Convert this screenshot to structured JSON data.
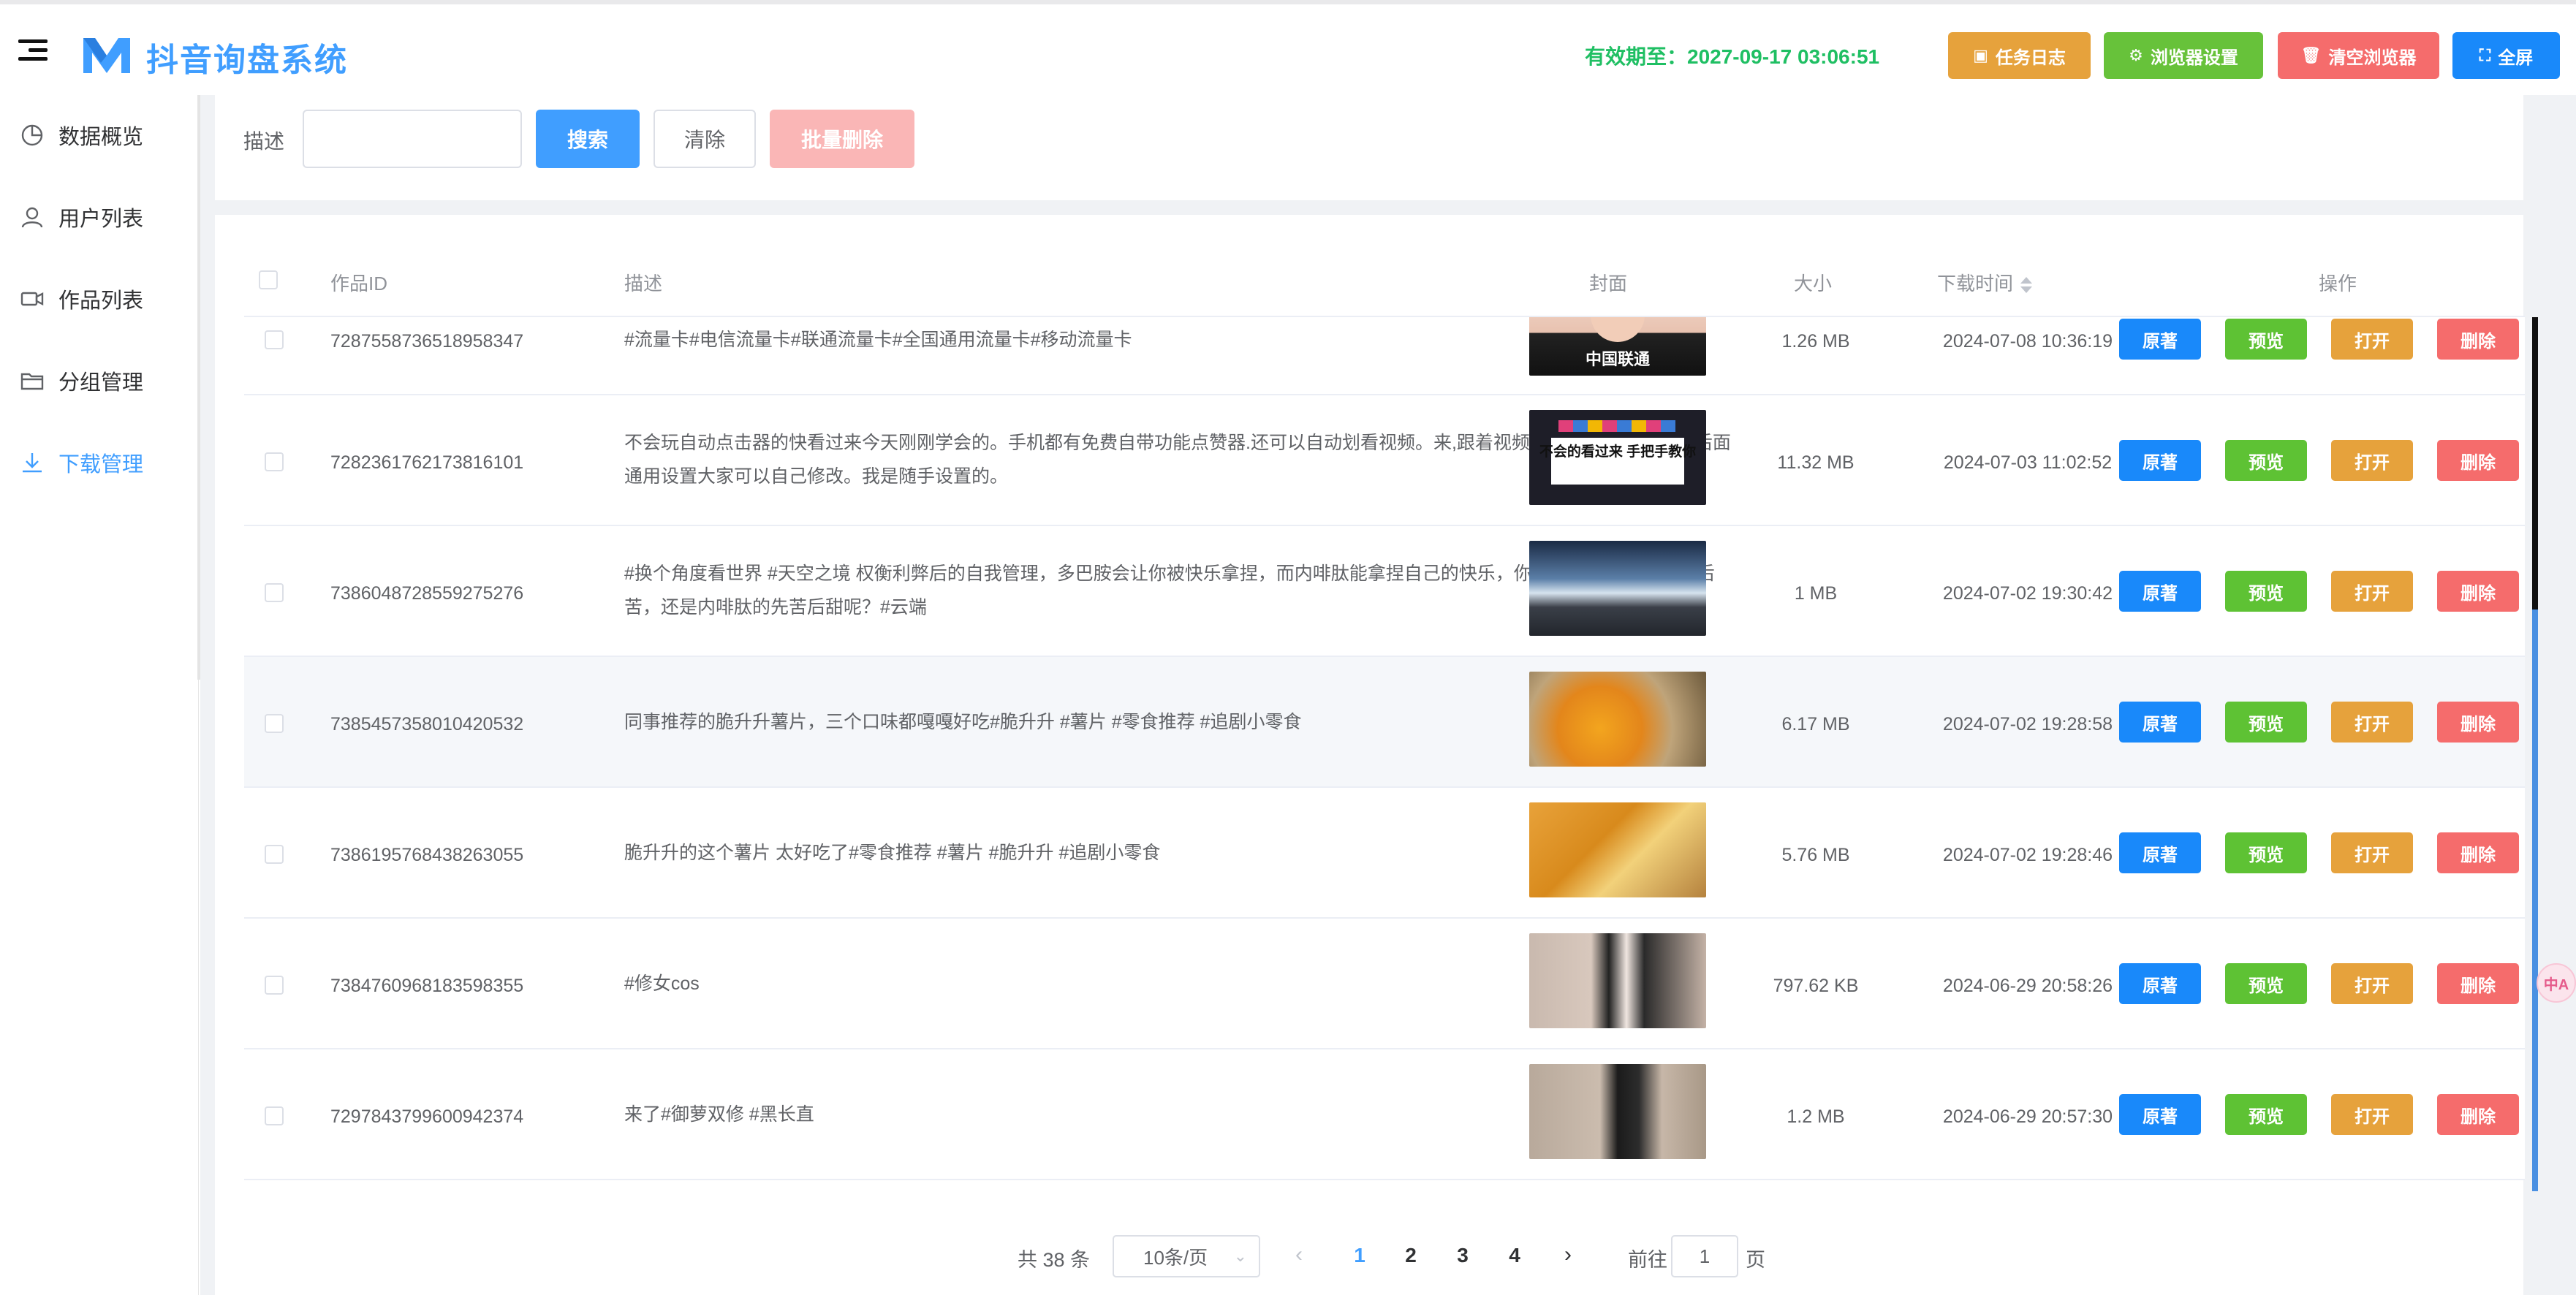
{
  "header": {
    "title": "抖音询盘系统",
    "expiry": "有效期至：2027-09-17 03:06:51",
    "buttons": {
      "task_log": "任务日志",
      "browser_settings": "浏览器设置",
      "clear_browser": "清空浏览器",
      "fullscreen": "全屏"
    }
  },
  "sidebar": {
    "items": [
      {
        "label": "数据概览",
        "icon": "pie-chart-icon"
      },
      {
        "label": "用户列表",
        "icon": "user-icon"
      },
      {
        "label": "作品列表",
        "icon": "video-camera-icon"
      },
      {
        "label": "分组管理",
        "icon": "folder-icon"
      },
      {
        "label": "下载管理",
        "icon": "download-icon",
        "active": true
      }
    ]
  },
  "search": {
    "label": "描述",
    "value": "",
    "placeholder": "",
    "search_btn": "搜索",
    "clear_btn": "清除",
    "batch_delete_btn": "批量删除"
  },
  "table": {
    "columns": {
      "id": "作品ID",
      "desc": "描述",
      "cover": "封面",
      "size": "大小",
      "time": "下载时间",
      "actions": "操作"
    },
    "action_labels": {
      "original": "原著",
      "preview": "预览",
      "open": "打开",
      "delete": "删除"
    },
    "rows": [
      {
        "id": "7287558736518958347",
        "desc": "#流量卡#电信流量卡#联通流量卡#全国通用流量卡#移动流量卡",
        "cover_text": "中国联通",
        "size": "1.26 MB",
        "time": "2024-07-08 10:36:19"
      },
      {
        "id": "7282361762173816101",
        "desc": "不会玩自动点击器的快看过来今天刚刚学会的。手机都有免费自带功能点赞器.还可以自动划看视频。来,跟着视频步骤一步一步走哦。后面通用设置大家可以自己修改。我是随手设置的。",
        "cover_text": "不会的看过来 手把手教你",
        "size": "11.32 MB",
        "time": "2024-07-03 11:02:52"
      },
      {
        "id": "7386048728559275276",
        "desc": "#换个角度看世界 #天空之境 权衡利弊后的自我管理，多巴胺会让你被快乐拿捏，而内啡肽能拿捏自己的快乐，你会选择多巴胺的先甜后苦，还是内啡肽的先苦后甜呢？#云端",
        "cover_text": "",
        "size": "1 MB",
        "time": "2024-07-02 19:30:42"
      },
      {
        "id": "7385457358010420532",
        "desc": "同事推荐的脆升升薯片，三个口味都嘎嘎好吃#脆升升 #薯片 #零食推荐 #追剧小零食",
        "cover_text": "",
        "size": "6.17 MB",
        "time": "2024-07-02 19:28:58"
      },
      {
        "id": "7386195768438263055",
        "desc": "脆升升的这个薯片 太好吃了#零食推荐 #薯片 #脆升升 #追剧小零食",
        "cover_text": "",
        "size": "5.76 MB",
        "time": "2024-07-02 19:28:46"
      },
      {
        "id": "7384760968183598355",
        "desc": "#修女cos",
        "cover_text": "",
        "size": "797.62 KB",
        "time": "2024-06-29 20:58:26"
      },
      {
        "id": "7297843799600942374",
        "desc": "来了#御萝双修 #黑长直",
        "cover_text": "",
        "size": "1.2 MB",
        "time": "2024-06-29 20:57:30"
      }
    ]
  },
  "pagination": {
    "total": "共 38 条",
    "page_size": "10条/页",
    "pages": [
      "1",
      "2",
      "3",
      "4"
    ],
    "current": "1",
    "goto_label": "前往",
    "goto_value": "1",
    "page_suffix": "页"
  },
  "translate_badge": "中A",
  "colors": {
    "primary": "#409eff",
    "success": "#67c23a",
    "warning": "#e6a23c",
    "danger": "#f56c6c",
    "expiry": "#1fbf63"
  }
}
